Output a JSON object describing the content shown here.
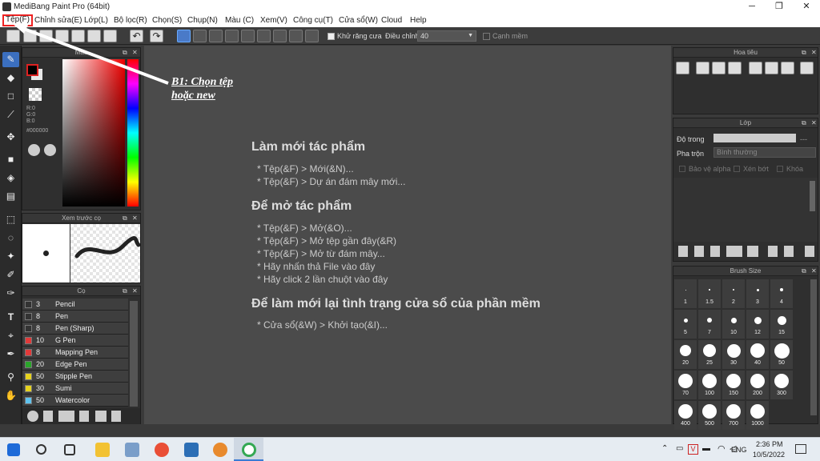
{
  "window": {
    "title": "MediBang Paint Pro (64bit)",
    "minimize": "─",
    "maximize": "❐",
    "close": "✕"
  },
  "menu": [
    "Tệp(F)",
    "Chỉnh sửa(E)",
    "Lớp(L)",
    "Bộ lọc(R)",
    "Chọn(S)",
    "Chụp(N)",
    "Màu (C)",
    "Xem(V)",
    "Công cụ(T)",
    "Cửa sổ(W)",
    "Cloud",
    "Help"
  ],
  "toolbar": {
    "antialias_label": "Khử răng cưa",
    "adjust_label": "Điều chỉnh",
    "adjust_value": "40",
    "edge_label": "Cạnh mềm"
  },
  "color_panel": {
    "title": "Màu",
    "r": "R:0",
    "g": "G:0",
    "b": "B:0",
    "hex": "#000000"
  },
  "preview_panel": {
    "title": "Xem trước cọ"
  },
  "brush_panel": {
    "title": "Cọ",
    "brushes": [
      {
        "size": "3",
        "name": "Pencil",
        "color": "#333333"
      },
      {
        "size": "8",
        "name": "Pen",
        "color": "#333333"
      },
      {
        "size": "8",
        "name": "Pen (Sharp)",
        "color": "#333333"
      },
      {
        "size": "10",
        "name": "G Pen",
        "color": "#e23a3a"
      },
      {
        "size": "8",
        "name": "Mapping Pen",
        "color": "#e23a3a"
      },
      {
        "size": "20",
        "name": "Edge Pen",
        "color": "#2aa52a"
      },
      {
        "size": "50",
        "name": "Stipple Pen",
        "color": "#e6d21e"
      },
      {
        "size": "30",
        "name": "Sumi",
        "color": "#e6d21e"
      },
      {
        "size": "50",
        "name": "Watercolor",
        "color": "#5fc3ee"
      }
    ]
  },
  "canvas": {
    "new_title": "Làm mới tác phẩm",
    "new_items": [
      "* Tệp(&F) > Mới(&N)...",
      "* Tệp(&F) > Dự án đám mây mới..."
    ],
    "open_title": "Để mở tác phẩm",
    "open_items": [
      "* Tệp(&F) > Mở(&O)...",
      "* Tệp(&F) > Mở tệp gần đây(&R)",
      "* Tệp(&F) > Mở từ đám mây...",
      "* Hãy nhấn thả File vào đây",
      "* Hãy click 2 lần chuột vào đây"
    ],
    "reset_title": "Để làm mới lại tình trạng cửa sổ của phần mềm",
    "reset_items": [
      "* Cửa sổ(&W) > Khởi tạo(&I)..."
    ]
  },
  "annotation": {
    "line1": "B1: Chọn tệp",
    "line2": "hoặc new"
  },
  "navigator_panel": {
    "title": "Hoa tiêu"
  },
  "layer_panel": {
    "title": "Lớp",
    "opacity_label": "Độ trong",
    "opacity_value": "---",
    "blend_label": "Pha trộn",
    "blend_value": "Bình thường",
    "protect_alpha": "Bảo vệ alpha",
    "clip": "Xén bớt",
    "lock": "Khóa"
  },
  "brush_size_panel": {
    "title": "Brush Size",
    "sizes": [
      "1",
      "1.5",
      "2",
      "3",
      "4",
      "5",
      "7",
      "10",
      "12",
      "15",
      "20",
      "25",
      "30",
      "40",
      "50",
      "70",
      "100",
      "150",
      "200",
      "300",
      "400",
      "500",
      "700",
      "1000"
    ]
  },
  "taskbar": {
    "language": "ENG",
    "time": "2:36 PM",
    "date": "10/5/2022"
  }
}
